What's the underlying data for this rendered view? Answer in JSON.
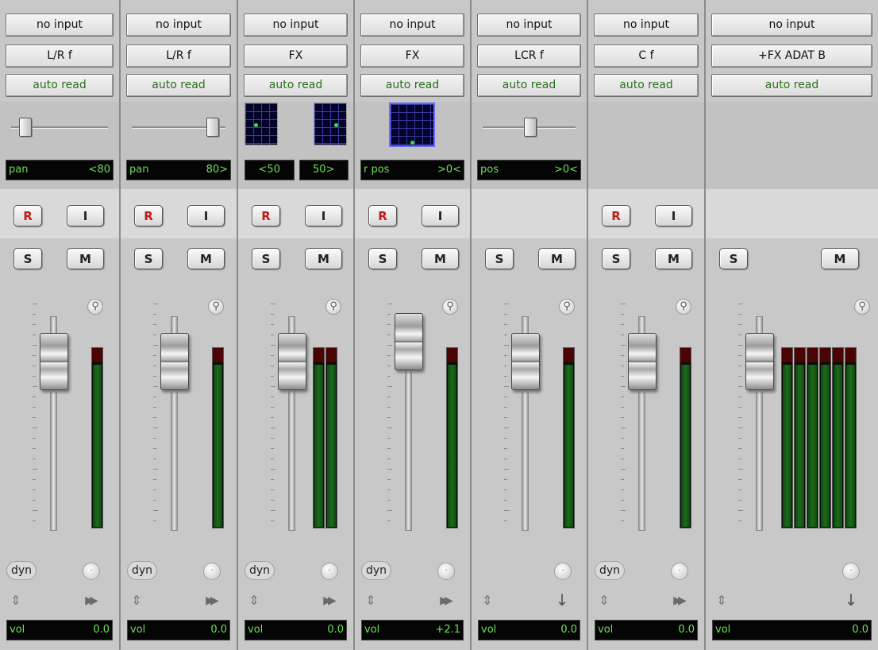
{
  "strips": [
    {
      "id": "s1",
      "input": "no input",
      "output": "L/R f",
      "automation": "auto read",
      "pan": {
        "type": "slider",
        "value": -80
      },
      "pan_readouts": [
        {
          "label": "pan",
          "value": "<80"
        }
      ],
      "has_rec": true,
      "rec": "R",
      "input_btn": "I",
      "solo": "S",
      "mute": "M",
      "fader_db": 0.0,
      "meters": 1,
      "dyn": "dyn",
      "arrow": "fast-forward",
      "vol_label": "vol",
      "vol_value": "0.0"
    },
    {
      "id": "s2",
      "input": "no input",
      "output": "L/R f",
      "automation": "auto read",
      "pan": {
        "type": "slider",
        "value": 80
      },
      "pan_readouts": [
        {
          "label": "pan",
          "value": "80>"
        }
      ],
      "has_rec": true,
      "rec": "R",
      "input_btn": "I",
      "solo": "S",
      "mute": "M",
      "fader_db": 0.0,
      "meters": 1,
      "dyn": "dyn",
      "arrow": "fast-forward",
      "vol_label": "vol",
      "vol_value": "0.0"
    },
    {
      "id": "s3",
      "input": "no input",
      "output": "FX",
      "automation": "auto read",
      "pan": {
        "type": "dual-grid"
      },
      "pan_readouts": [
        {
          "label": "",
          "value": "<50"
        },
        {
          "label": "",
          "value": "50>"
        }
      ],
      "has_rec": true,
      "rec": "R",
      "input_btn": "I",
      "solo": "S",
      "mute": "M",
      "fader_db": 0.0,
      "meters": 2,
      "dyn": "dyn",
      "arrow": "fast-forward",
      "vol_label": "vol",
      "vol_value": "0.0"
    },
    {
      "id": "s4",
      "input": "no input",
      "output": "FX",
      "automation": "auto read",
      "pan": {
        "type": "surround-grid"
      },
      "pan_readouts": [
        {
          "label": "r pos",
          "value": ">0<"
        }
      ],
      "has_rec": true,
      "rec": "R",
      "input_btn": "I",
      "solo": "S",
      "mute": "M",
      "fader_db": 2.1,
      "meters": 1,
      "dyn": "dyn",
      "arrow": "fast-forward",
      "vol_label": "vol",
      "vol_value": "+2.1"
    },
    {
      "id": "s5",
      "input": "no input",
      "output": "LCR f",
      "automation": "auto read",
      "pan": {
        "type": "slider",
        "value": 0
      },
      "pan_readouts": [
        {
          "label": "pos",
          "value": ">0<"
        }
      ],
      "has_rec": false,
      "rec": "",
      "input_btn": "",
      "solo": "S",
      "mute": "M",
      "fader_db": 0.0,
      "meters": 1,
      "dyn": "",
      "arrow": "down",
      "vol_label": "vol",
      "vol_value": "0.0"
    },
    {
      "id": "s6",
      "input": "no input",
      "output": "C f",
      "automation": "auto read",
      "pan": {
        "type": "none"
      },
      "pan_readouts": [],
      "has_rec": true,
      "rec": "R",
      "input_btn": "I",
      "solo": "S",
      "mute": "M",
      "fader_db": 0.0,
      "meters": 1,
      "dyn": "dyn",
      "arrow": "fast-forward",
      "vol_label": "vol",
      "vol_value": "0.0"
    },
    {
      "id": "s7",
      "input": "no input",
      "output": "+FX ADAT B",
      "automation": "auto read",
      "pan": {
        "type": "none"
      },
      "pan_readouts": [],
      "has_rec": false,
      "rec": "",
      "input_btn": "",
      "solo": "S",
      "mute": "M",
      "fader_db": 0.0,
      "meters": 6,
      "dyn": "",
      "arrow": "down",
      "vol_label": "vol",
      "vol_value": "0.0"
    }
  ],
  "icons": {
    "automation_dot": "dot-icon",
    "up_down": "up-down-arrow-icon",
    "fast_forward": "fast-forward-icon",
    "down": "down-arrow-icon",
    "pan_knob": "knob-icon"
  },
  "colors": {
    "readout_text": "#6ee05a",
    "record": "#c41a1a",
    "meter_level": "#1d6a1d",
    "meter_clip": "#4a0404",
    "grid_bg": "#04042a"
  }
}
